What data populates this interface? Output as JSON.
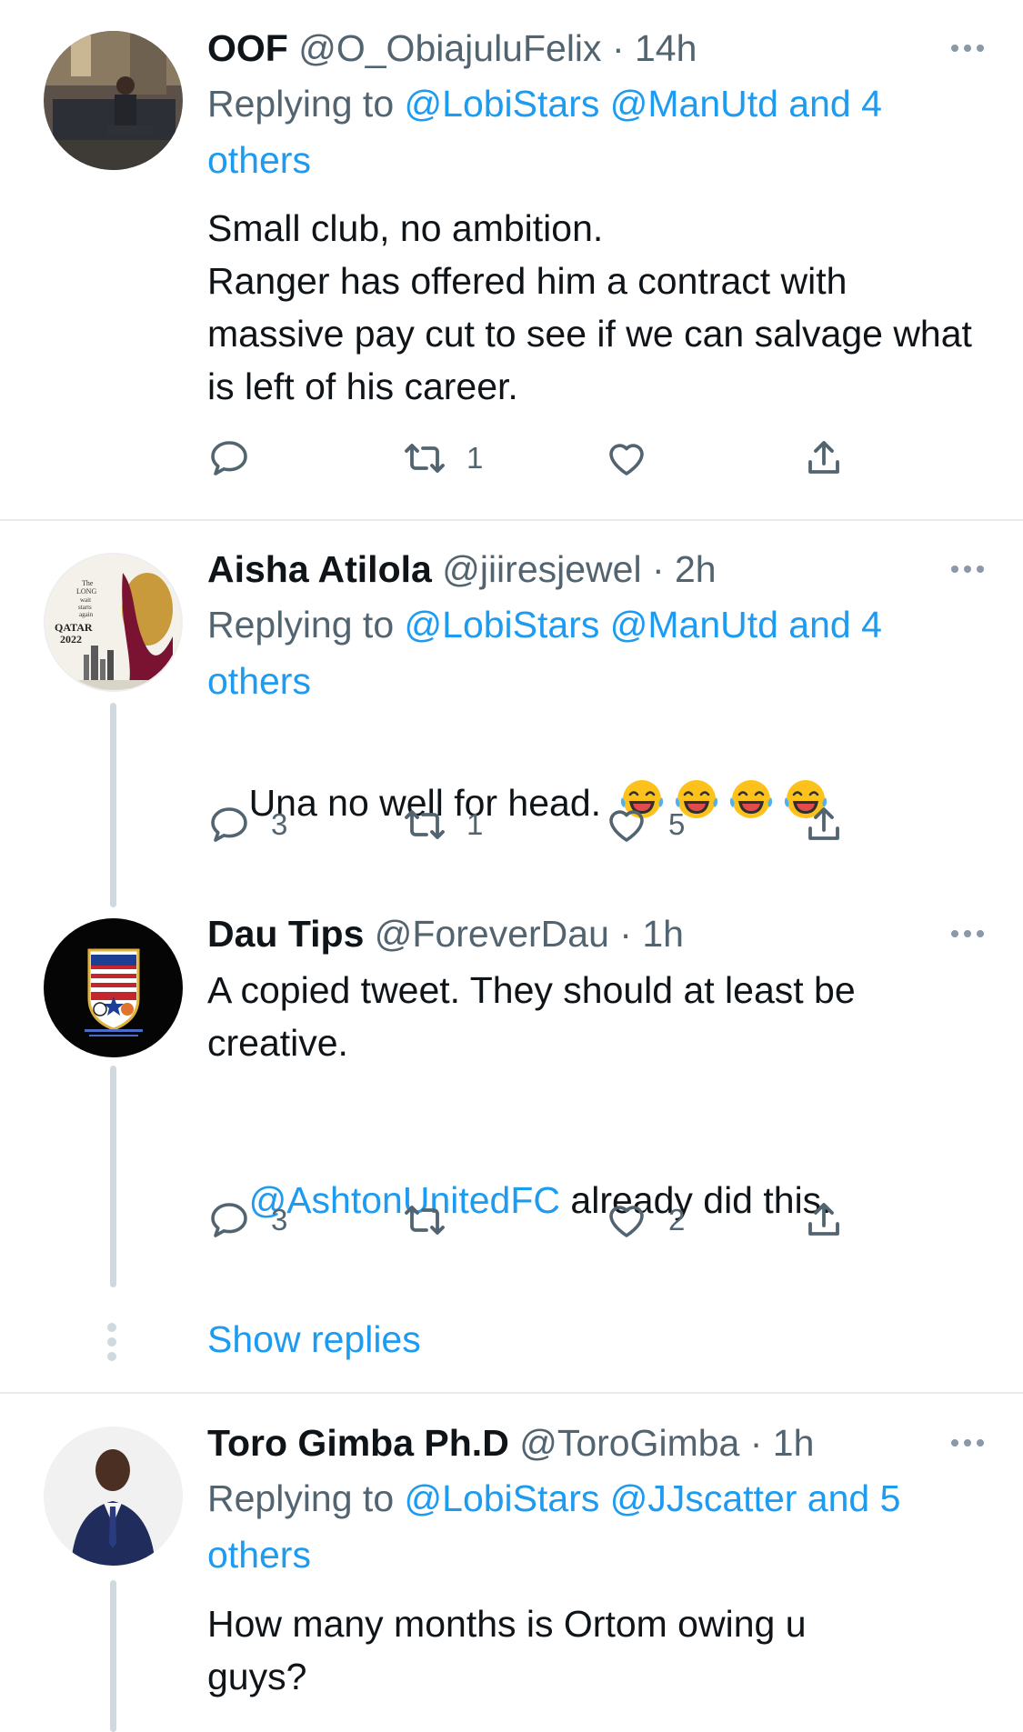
{
  "tweets": [
    {
      "name": "OOF",
      "handle": "@O_ObiajuluFelix",
      "dot": " · ",
      "time": "14h",
      "replying_prefix": "Replying to ",
      "replying_links": "@LobiStars @ManUtd and 4",
      "replying_tail": "others",
      "text": "Small club, no ambition.\nRanger has offered him a contract with massive pay cut to see if we can salvage what is left of his career.",
      "counts": {
        "reply": "",
        "retweet": "1",
        "like": ""
      }
    },
    {
      "name": "Aisha Atilola",
      "handle": "@jiiresjewel",
      "dot": " · ",
      "time": "2h",
      "replying_prefix": "Replying to ",
      "replying_links": "@LobiStars @ManUtd and 4",
      "replying_tail": "others",
      "text": "Una no well for head. ",
      "avatar_text": {
        "line1": "The",
        "line2": "LONG",
        "line3": "wait",
        "line4": "starts",
        "line5": "again",
        "line6": "QATAR",
        "line7": "2022"
      },
      "counts": {
        "reply": "3",
        "retweet": "1",
        "like": "5"
      }
    },
    {
      "name": "Dau Tips",
      "handle": "@ForeverDau",
      "dot": " · ",
      "time": "1h",
      "text": "A copied tweet. They should at least be creative.",
      "mention": "@AshtonUnitedFC",
      "text2": " already did this.",
      "counts": {
        "reply": "3",
        "retweet": "",
        "like": "2"
      }
    },
    {
      "name": "Toro Gimba Ph.D",
      "handle": "@ToroGimba",
      "dot": " · ",
      "time": "1h",
      "replying_prefix": "Replying to ",
      "replying_links": "@LobiStars @JJscatter and 5",
      "replying_tail": "others",
      "text": "How many months is Ortom owing u guys?"
    }
  ],
  "show_replies": "Show replies",
  "icons": {
    "reply": "reply-icon",
    "retweet": "retweet-icon",
    "like": "heart-icon",
    "share": "share-icon",
    "more": "more-icon",
    "emoji": "laughing-tears-emoji"
  },
  "colors": {
    "link": "#1d9bf0",
    "secondary": "#536471",
    "line": "#cfd9de"
  }
}
